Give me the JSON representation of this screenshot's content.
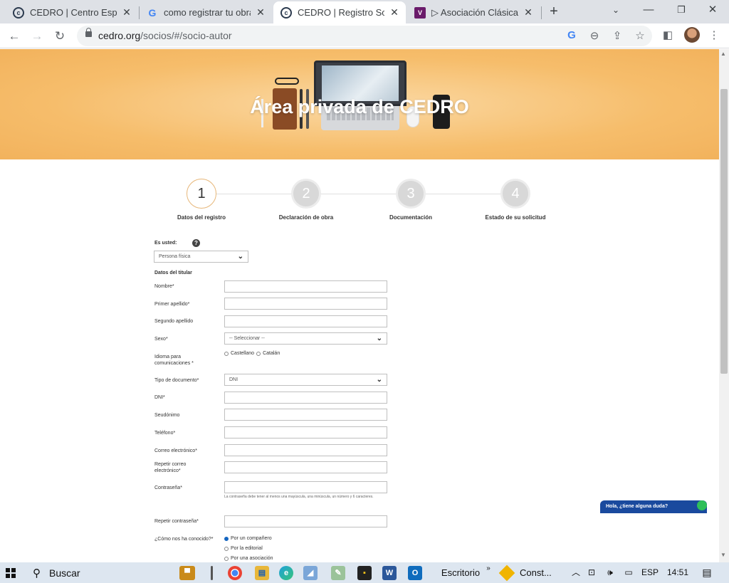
{
  "browser": {
    "tabs": [
      {
        "title": "CEDRO | Centro Español",
        "favicon": "cedro-icon",
        "active": false
      },
      {
        "title": "como registrar tu obra",
        "favicon": "google-icon",
        "active": false
      },
      {
        "title": "CEDRO | Registro Socio",
        "favicon": "cedro-icon",
        "active": true
      },
      {
        "title": "▷ Asociación Clásicas y",
        "favicon": "purple-site-icon",
        "active": false
      }
    ],
    "url_domain": "cedro.org",
    "url_path": "/socios/#/socio-autor"
  },
  "page": {
    "hero_title": "Área privada de CEDRO",
    "steps": [
      {
        "number": "1",
        "label": "Datos del registro"
      },
      {
        "number": "2",
        "label": "Declaración de obra"
      },
      {
        "number": "3",
        "label": "Documentación"
      },
      {
        "number": "4",
        "label": "Estado de su solicitud"
      }
    ],
    "form": {
      "es_usted_label": "Es usted:",
      "es_usted_value": "Persona física",
      "section_title": "Datos del titular",
      "nombre": "Nombre*",
      "primer_apellido": "Primer apellido*",
      "segundo_apellido": "Segundo apellido",
      "sexo": "Sexo*",
      "sexo_value": "-- Seleccionar --",
      "idioma": "Idioma para comunicaciones *",
      "idioma_opt1": "Castellano",
      "idioma_opt2": "Catalán",
      "tipo_documento": "Tipo de documento*",
      "tipo_documento_value": "DNI",
      "dni": "DNI*",
      "seudonimo": "Seudónimo",
      "telefono": "Teléfono*",
      "correo": "Correo electrónico*",
      "repetir_correo": "Repetir correo electrónico*",
      "contrasena": "Contraseña*",
      "contrasena_hint": "La contraseña debe tener al menos una mayúscula, una minúscula, un número y 6 caracteres.",
      "repetir_contrasena": "Repetir contraseña*",
      "como_conocido": "¿Cómo nos ha conocido?*",
      "conocido_opts": [
        "Por un compañero",
        "Por la editorial",
        "Por una asociación"
      ]
    },
    "chat_text": "Hola, ¿tiene alguna duda?"
  },
  "taskbar": {
    "search_label": "Buscar",
    "escritorio": "Escritorio",
    "chevrons": "»",
    "pinned_app": "Const...",
    "language": "ESP",
    "time": "14:51"
  }
}
